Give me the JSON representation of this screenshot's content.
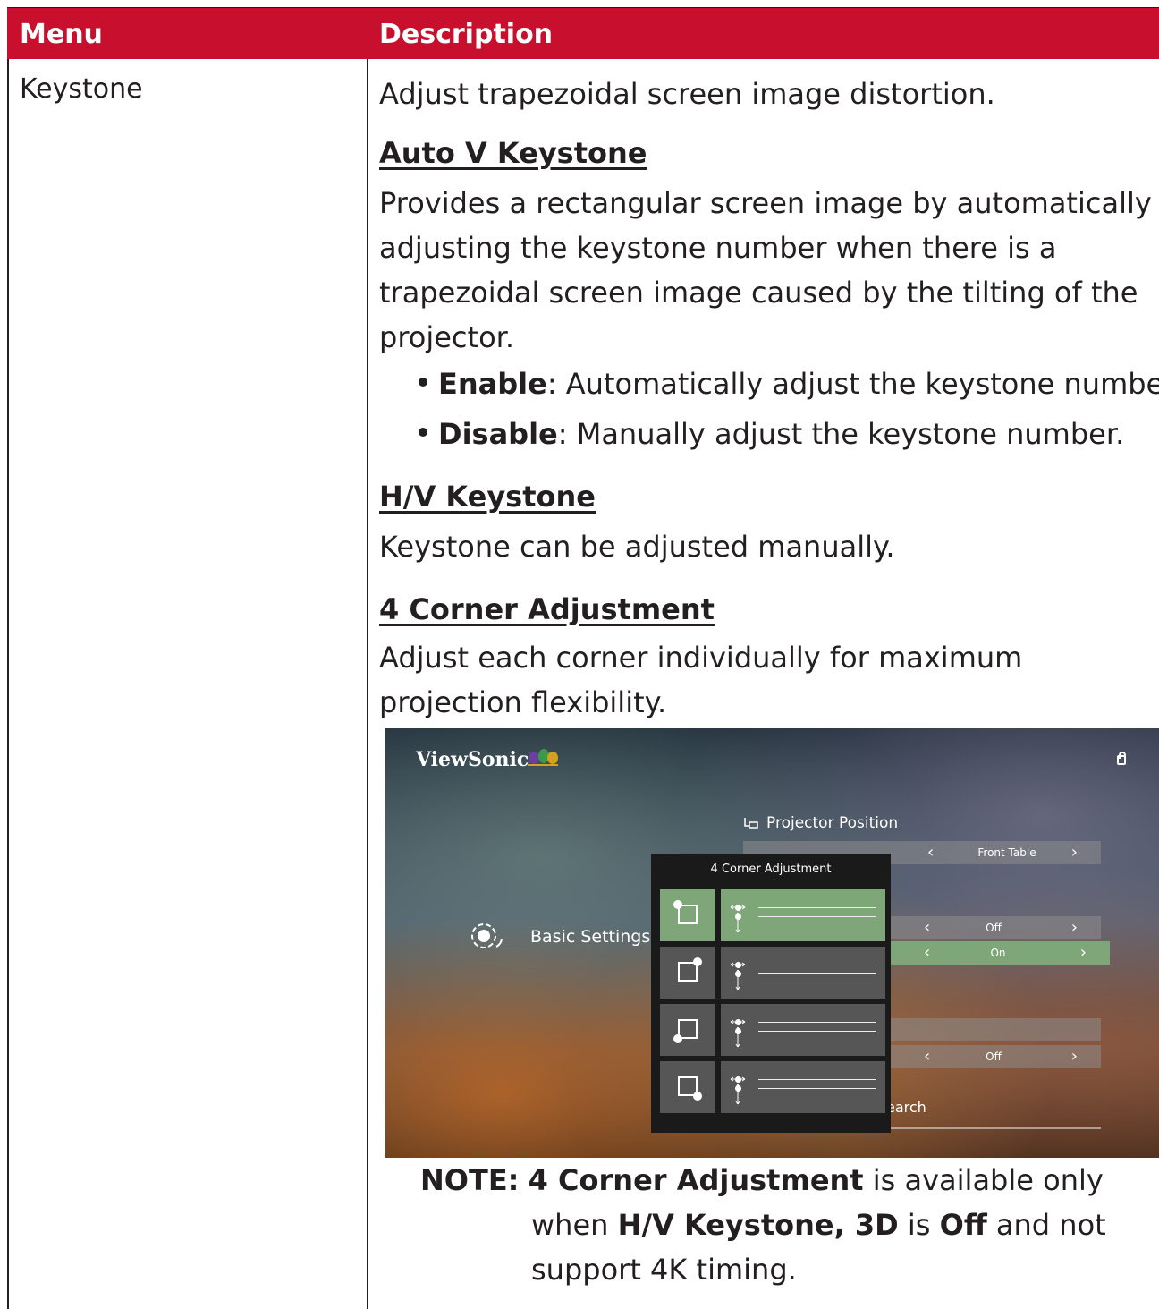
{
  "header": {
    "menu": "Menu",
    "description": "Description"
  },
  "menu_item": "Keystone",
  "description": {
    "intro": "Adjust trapezoidal screen image distortion.",
    "auto_v": {
      "title": "Auto V Keystone",
      "lines": [
        "Provides a rectangular screen image by automatically",
        "adjusting the keystone number when there is a",
        "trapezoidal screen image caused by the tilting of the",
        "projector."
      ],
      "bullets": [
        {
          "term": "Enable",
          "text": ": Automatically adjust the keystone number."
        },
        {
          "term": "Disable",
          "text": ": Manually adjust the keystone number."
        }
      ]
    },
    "hv": {
      "title": "H/V Keystone",
      "text": "Keystone can be adjusted manually."
    },
    "corner": {
      "title": "4 Corner Adjustment",
      "lines": [
        "Adjust each corner individually for maximum",
        "projection flexibility."
      ]
    }
  },
  "screenshot": {
    "brand": "ViewSonic",
    "projector_position_label": "Projector Position",
    "basic_settings_label": "Basic Settings",
    "panel_title": "4 Corner Adjustment",
    "options": {
      "front_table": "Front Table",
      "off1": "Off",
      "on": "On",
      "off2": "Off"
    },
    "search_fragment": "earch",
    "icons": [
      "gear-icon",
      "lock-icon",
      "projector-position-icon"
    ]
  },
  "note": {
    "label": "NOTE:",
    "bold1": "4 Corner Adjustment",
    "t1": " is available only",
    "t2a": "when  ",
    "bold2": "H/V Keystone, 3D",
    "t2b": " is ",
    "bold3": "Off",
    "t2c": " and not",
    "t3": "support 4K timing."
  },
  "colors": {
    "header_bg": "#c8102e",
    "selected_green": "#7fa679"
  }
}
